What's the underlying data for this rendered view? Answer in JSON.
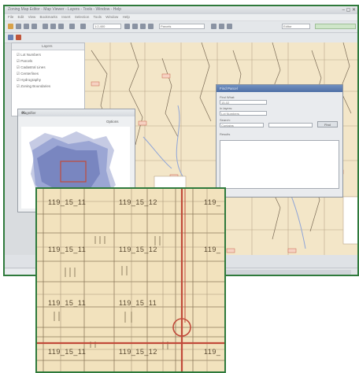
{
  "app": {
    "title": "Zoning Map Editor - Map Viewer - Layers - Tools - Window - Help",
    "menu": [
      "File",
      "Edit",
      "View",
      "Bookmarks",
      "Insert",
      "Selection",
      "Tools",
      "Window",
      "Help"
    ],
    "toolbar": {
      "scale": "1:2,400",
      "layer": "Parcels",
      "editor": "Editor"
    }
  },
  "toc": {
    "header": "Layers",
    "items": [
      "Lot Numbers",
      "Parcels",
      "Cadastral Lines",
      "Centerlines",
      "Hydrography",
      "Zoning Boundaries"
    ]
  },
  "magnifier": {
    "title": "Magnifier",
    "options_label": "Options"
  },
  "dialog": {
    "title": "Find Parcel",
    "labels": {
      "find": "Find What:",
      "in": "In layers:",
      "search": "Search:",
      "results": "Results"
    },
    "fields": {
      "find_value": "15-02",
      "in_value": "Lot Numbers",
      "search_value": "Contains"
    },
    "button": "Find"
  },
  "zoom": {
    "labels": [
      "119_15_11",
      "119_15_12",
      "119_",
      "119_15_11",
      "119_15_12",
      "119_",
      "119_15_11",
      "119_15_11",
      "119_15_11",
      "119_15_12",
      "119_"
    ]
  },
  "colors": {
    "frame": "#2f7a3c",
    "parcel_bg": "#f2e2bd",
    "road": "#c14a3a",
    "line": "#8c7a5c"
  }
}
